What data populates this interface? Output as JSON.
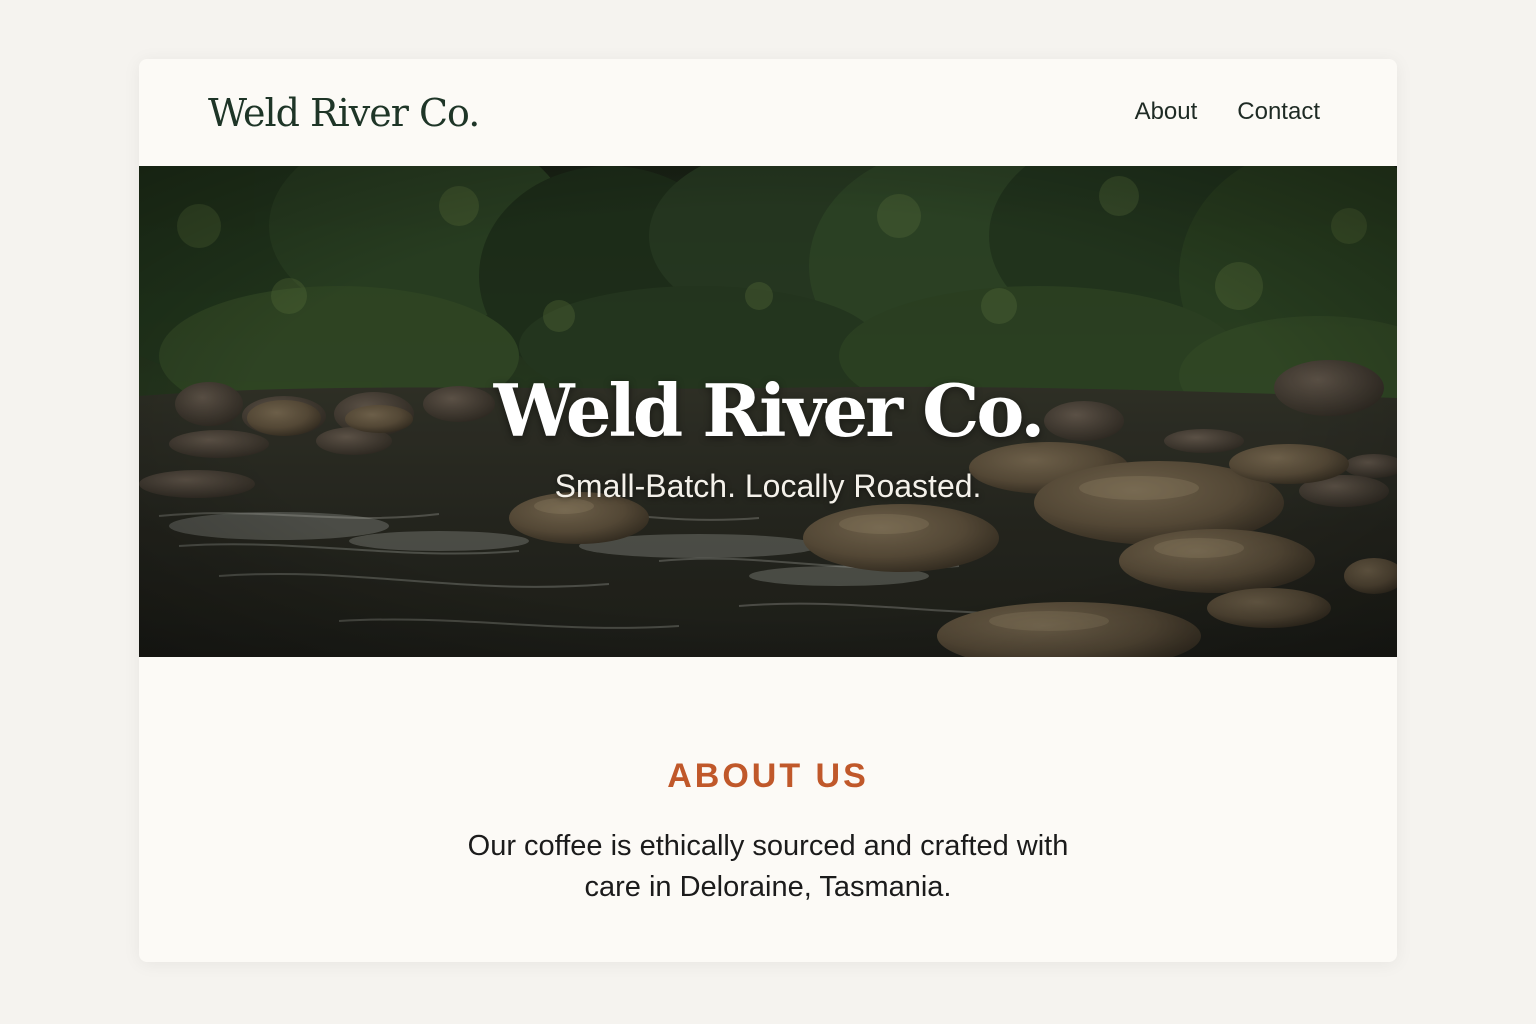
{
  "header": {
    "logo": "Weld River Co.",
    "nav": [
      {
        "label": "About"
      },
      {
        "label": "Contact"
      }
    ]
  },
  "hero": {
    "title": "Weld River Co.",
    "subtitle": "Small-Batch. Locally Roasted."
  },
  "about": {
    "heading": "ABOUT US",
    "text": "Our coffee is ethically sourced and crafted with care in Deloraine, Tasmania."
  },
  "colors": {
    "page_background": "#f5f3ef",
    "card_background": "#fcfaf6",
    "logo_green": "#1e3527",
    "accent_orange": "#c0582a",
    "body_text": "#1b1b1b"
  }
}
